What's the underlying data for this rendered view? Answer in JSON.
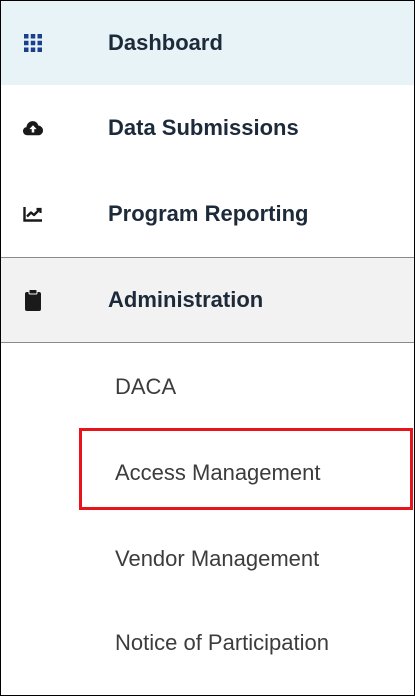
{
  "sidebar": {
    "items": [
      {
        "label": "Dashboard",
        "icon": "grid-icon"
      },
      {
        "label": "Data Submissions",
        "icon": "cloud-upload-icon"
      },
      {
        "label": "Program Reporting",
        "icon": "chart-line-icon"
      },
      {
        "label": "Administration",
        "icon": "clipboard-icon"
      }
    ],
    "admin_sub_items": [
      {
        "label": "DACA"
      },
      {
        "label": "Access Management"
      },
      {
        "label": "Vendor Management"
      },
      {
        "label": "Notice of Participation"
      }
    ]
  },
  "colors": {
    "highlight": "#e8141c",
    "dashboard_bg": "#e8f3f8",
    "admin_bg": "#f2f2f2",
    "grid_icon": "#1b3f8b"
  }
}
